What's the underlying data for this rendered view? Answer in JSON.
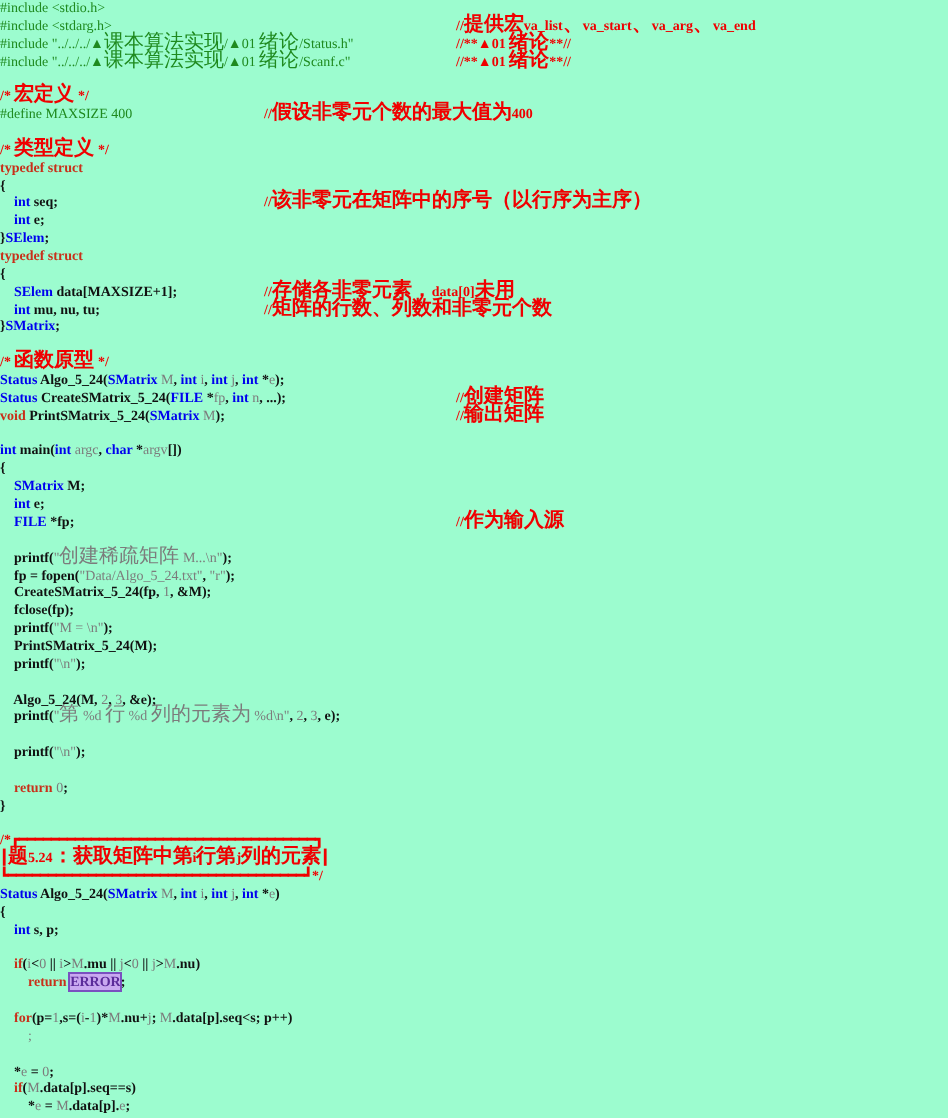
{
  "editor": {
    "lines": [
      {
        "kind": "code",
        "segments": [
          {
            "kind": "pre",
            "text": "#include <stdio.h>"
          }
        ]
      },
      {
        "kind": "code",
        "segments": [
          {
            "kind": "pre",
            "text": "#include <stdarg.h>"
          }
        ],
        "comment_far": "//提供宏va_list、va_start、va_arg、va_end"
      },
      {
        "kind": "code",
        "segments": [
          {
            "kind": "pre",
            "text": "#include \"../../../▲课本算法实现/▲01 绪论/Status.h\""
          }
        ],
        "comment_far": "//**▲01 绪论**//"
      },
      {
        "kind": "code",
        "segments": [
          {
            "kind": "pre",
            "text": "#include \"../../../▲课本算法实现/▲01 绪论/Scanf.c\""
          }
        ],
        "comment_far": "//**▲01 绪论**//"
      },
      {
        "kind": "blank"
      },
      {
        "kind": "code",
        "segments": [
          {
            "kind": "cmt",
            "text": "/* 宏定义 */"
          }
        ]
      },
      {
        "kind": "code",
        "segments": [
          {
            "kind": "pre",
            "text": "#define MAXSIZE 400"
          }
        ],
        "comment_mid": "//假设非零元个数的最大值为400"
      },
      {
        "kind": "blank"
      },
      {
        "kind": "code",
        "segments": [
          {
            "kind": "cmt",
            "text": "/* 类型定义 */"
          }
        ]
      },
      {
        "kind": "code",
        "segments": [
          {
            "kind": "ctl",
            "text": "typedef struct"
          }
        ]
      },
      {
        "kind": "code",
        "segments": [
          {
            "kind": "plain",
            "text": "{"
          }
        ]
      },
      {
        "kind": "code",
        "segments": [
          {
            "kind": "kw",
            "text": "    int"
          },
          {
            "kind": "plain",
            "text": " seq;"
          }
        ],
        "comment_mid": "//该非零元在矩阵中的序号（以行序为主序）"
      },
      {
        "kind": "code",
        "segments": [
          {
            "kind": "kw",
            "text": "    int"
          },
          {
            "kind": "plain",
            "text": " e;"
          }
        ]
      },
      {
        "kind": "code",
        "segments": [
          {
            "kind": "plain",
            "text": "}"
          },
          {
            "kind": "kw",
            "text": "SElem"
          },
          {
            "kind": "plain",
            "text": ";"
          }
        ]
      },
      {
        "kind": "code",
        "segments": [
          {
            "kind": "ctl",
            "text": "typedef struct"
          }
        ]
      },
      {
        "kind": "code",
        "segments": [
          {
            "kind": "plain",
            "text": "{"
          }
        ]
      },
      {
        "kind": "code",
        "segments": [
          {
            "kind": "kw",
            "text": "    SElem"
          },
          {
            "kind": "plain",
            "text": " data[MAXSIZE+1];"
          }
        ],
        "comment_mid": "//存储各非零元素，data[0]未用"
      },
      {
        "kind": "code",
        "segments": [
          {
            "kind": "kw",
            "text": "    int"
          },
          {
            "kind": "plain",
            "text": " mu, nu, tu;"
          }
        ],
        "comment_mid": "//矩阵的行数、列数和非零元个数"
      },
      {
        "kind": "code",
        "segments": [
          {
            "kind": "plain",
            "text": "}"
          },
          {
            "kind": "kw",
            "text": "SMatrix"
          },
          {
            "kind": "plain",
            "text": ";"
          }
        ]
      },
      {
        "kind": "blank"
      },
      {
        "kind": "code",
        "segments": [
          {
            "kind": "cmt",
            "text": "/* 函数原型 */"
          }
        ]
      },
      {
        "kind": "code",
        "segments": [
          {
            "kind": "kw",
            "text": "Status"
          },
          {
            "kind": "plain",
            "text": " Algo_5_24("
          },
          {
            "kind": "kw",
            "text": "SMatrix"
          },
          {
            "kind": "param",
            "text": " M"
          },
          {
            "kind": "plain",
            "text": ", "
          },
          {
            "kind": "kw",
            "text": "int"
          },
          {
            "kind": "param",
            "text": " i"
          },
          {
            "kind": "plain",
            "text": ", "
          },
          {
            "kind": "kw",
            "text": "int"
          },
          {
            "kind": "param",
            "text": " j"
          },
          {
            "kind": "plain",
            "text": ", "
          },
          {
            "kind": "kw",
            "text": "int"
          },
          {
            "kind": "plain",
            "text": " *"
          },
          {
            "kind": "param",
            "text": "e"
          },
          {
            "kind": "plain",
            "text": ");"
          }
        ]
      },
      {
        "kind": "code",
        "segments": [
          {
            "kind": "kw",
            "text": "Status"
          },
          {
            "kind": "plain",
            "text": " CreateSMatrix_5_24("
          },
          {
            "kind": "kw",
            "text": "FILE"
          },
          {
            "kind": "plain",
            "text": " *"
          },
          {
            "kind": "param",
            "text": "fp"
          },
          {
            "kind": "plain",
            "text": ", "
          },
          {
            "kind": "kw",
            "text": "int"
          },
          {
            "kind": "param",
            "text": " n"
          },
          {
            "kind": "plain",
            "text": ", ...);"
          }
        ],
        "comment_far": "//创建矩阵"
      },
      {
        "kind": "code",
        "segments": [
          {
            "kind": "ctl",
            "text": "void"
          },
          {
            "kind": "plain",
            "text": " PrintSMatrix_5_24("
          },
          {
            "kind": "kw",
            "text": "SMatrix"
          },
          {
            "kind": "param",
            "text": " M"
          },
          {
            "kind": "plain",
            "text": ");"
          }
        ],
        "comment_far": "//输出矩阵"
      },
      {
        "kind": "blank"
      },
      {
        "kind": "code",
        "segments": [
          {
            "kind": "kw",
            "text": "int"
          },
          {
            "kind": "plain",
            "text": " main("
          },
          {
            "kind": "kw",
            "text": "int"
          },
          {
            "kind": "param",
            "text": " argc"
          },
          {
            "kind": "plain",
            "text": ", "
          },
          {
            "kind": "kw",
            "text": "char"
          },
          {
            "kind": "plain",
            "text": " *"
          },
          {
            "kind": "param",
            "text": "argv"
          },
          {
            "kind": "plain",
            "text": "[])"
          }
        ]
      },
      {
        "kind": "code",
        "segments": [
          {
            "kind": "plain",
            "text": "{"
          }
        ]
      },
      {
        "kind": "code",
        "segments": [
          {
            "kind": "kw",
            "text": "    SMatrix"
          },
          {
            "kind": "plain",
            "text": " M;"
          }
        ]
      },
      {
        "kind": "code",
        "segments": [
          {
            "kind": "kw",
            "text": "    int"
          },
          {
            "kind": "plain",
            "text": " e;"
          }
        ]
      },
      {
        "kind": "code",
        "segments": [
          {
            "kind": "kw",
            "text": "    FILE"
          },
          {
            "kind": "plain",
            "text": " *fp;"
          }
        ],
        "comment_far": "//作为输入源"
      },
      {
        "kind": "blank"
      },
      {
        "kind": "code",
        "segments": [
          {
            "kind": "plain",
            "text": "    printf("
          },
          {
            "kind": "str",
            "text": "\"创建稀疏矩阵 M...\\n\""
          },
          {
            "kind": "plain",
            "text": ");"
          }
        ]
      },
      {
        "kind": "code",
        "segments": [
          {
            "kind": "plain",
            "text": "    fp = fopen("
          },
          {
            "kind": "str",
            "text": "\"Data/Algo_5_24.txt\""
          },
          {
            "kind": "plain",
            "text": ", "
          },
          {
            "kind": "str",
            "text": "\"r\""
          },
          {
            "kind": "plain",
            "text": ");"
          }
        ]
      },
      {
        "kind": "code",
        "segments": [
          {
            "kind": "plain",
            "text": "    CreateSMatrix_5_24(fp, "
          },
          {
            "kind": "num",
            "text": "1"
          },
          {
            "kind": "plain",
            "text": ", &M);"
          }
        ]
      },
      {
        "kind": "code",
        "segments": [
          {
            "kind": "plain",
            "text": "    fclose(fp);"
          }
        ]
      },
      {
        "kind": "code",
        "segments": [
          {
            "kind": "plain",
            "text": "    printf("
          },
          {
            "kind": "str",
            "text": "\"M = \\n\""
          },
          {
            "kind": "plain",
            "text": ");"
          }
        ]
      },
      {
        "kind": "code",
        "segments": [
          {
            "kind": "plain",
            "text": "    PrintSMatrix_5_24(M);"
          }
        ]
      },
      {
        "kind": "code",
        "segments": [
          {
            "kind": "plain",
            "text": "    printf("
          },
          {
            "kind": "str",
            "text": "\"\\n\""
          },
          {
            "kind": "plain",
            "text": ");"
          }
        ]
      },
      {
        "kind": "blank"
      },
      {
        "kind": "code",
        "segments": [
          {
            "kind": "plain",
            "text": "    Algo_5_24(M, "
          },
          {
            "kind": "num",
            "text": "2"
          },
          {
            "kind": "plain",
            "text": ", "
          },
          {
            "kind": "num",
            "text": "3"
          },
          {
            "kind": "plain",
            "text": ", &e);"
          }
        ]
      },
      {
        "kind": "code",
        "segments": [
          {
            "kind": "plain",
            "text": "    printf("
          },
          {
            "kind": "str",
            "text": "\"第 %d 行 %d 列的元素为 %d\\n\""
          },
          {
            "kind": "plain",
            "text": ", "
          },
          {
            "kind": "num",
            "text": "2"
          },
          {
            "kind": "plain",
            "text": ", "
          },
          {
            "kind": "num",
            "text": "3"
          },
          {
            "kind": "plain",
            "text": ", e);"
          }
        ]
      },
      {
        "kind": "blank"
      },
      {
        "kind": "code",
        "segments": [
          {
            "kind": "plain",
            "text": "    printf("
          },
          {
            "kind": "str",
            "text": "\"\\n\""
          },
          {
            "kind": "plain",
            "text": ");"
          }
        ]
      },
      {
        "kind": "blank"
      },
      {
        "kind": "code",
        "segments": [
          {
            "kind": "ctl",
            "text": "    return "
          },
          {
            "kind": "num",
            "text": "0"
          },
          {
            "kind": "plain",
            "text": ";"
          }
        ]
      },
      {
        "kind": "code",
        "segments": [
          {
            "kind": "plain",
            "text": "}"
          }
        ]
      },
      {
        "kind": "blank"
      },
      {
        "kind": "code",
        "segments": [
          {
            "kind": "cmt",
            "text": "/*┏━━━━━━━━━━━━━━━━━━━━━━━━━━━━━━━━━━━━━┓"
          }
        ]
      },
      {
        "kind": "code",
        "segments": [
          {
            "kind": "cmt",
            "text": "┃题5.24：获取矩阵中第i行第j列的元素┃"
          }
        ]
      },
      {
        "kind": "code",
        "segments": [
          {
            "kind": "cmt",
            "text": "┗━━━━━━━━━━━━━━━━━━━━━━━━━━━━━━━━━━━━━┛*/"
          }
        ]
      },
      {
        "kind": "code",
        "segments": [
          {
            "kind": "kw",
            "text": "Status"
          },
          {
            "kind": "plain",
            "text": " Algo_5_24("
          },
          {
            "kind": "kw",
            "text": "SMatrix"
          },
          {
            "kind": "param",
            "text": " M"
          },
          {
            "kind": "plain",
            "text": ", "
          },
          {
            "kind": "kw",
            "text": "int"
          },
          {
            "kind": "param",
            "text": " i"
          },
          {
            "kind": "plain",
            "text": ", "
          },
          {
            "kind": "kw",
            "text": "int"
          },
          {
            "kind": "param",
            "text": " j"
          },
          {
            "kind": "plain",
            "text": ", "
          },
          {
            "kind": "kw",
            "text": "int"
          },
          {
            "kind": "plain",
            "text": " *"
          },
          {
            "kind": "param",
            "text": "e"
          },
          {
            "kind": "plain",
            "text": ")"
          }
        ]
      },
      {
        "kind": "code",
        "segments": [
          {
            "kind": "plain",
            "text": "{"
          }
        ]
      },
      {
        "kind": "code",
        "segments": [
          {
            "kind": "kw",
            "text": "    int"
          },
          {
            "kind": "plain",
            "text": " s, p;"
          }
        ]
      },
      {
        "kind": "blank"
      },
      {
        "kind": "code",
        "segments": [
          {
            "kind": "ctl",
            "text": "    if"
          },
          {
            "kind": "plain",
            "text": "("
          },
          {
            "kind": "param",
            "text": "i"
          },
          {
            "kind": "plain",
            "text": "<"
          },
          {
            "kind": "num",
            "text": "0"
          },
          {
            "kind": "plain",
            "text": " || "
          },
          {
            "kind": "param",
            "text": "i"
          },
          {
            "kind": "plain",
            "text": ">"
          },
          {
            "kind": "param",
            "text": "M"
          },
          {
            "kind": "plain",
            "text": ".mu || "
          },
          {
            "kind": "param",
            "text": "j"
          },
          {
            "kind": "plain",
            "text": "<"
          },
          {
            "kind": "num",
            "text": "0"
          },
          {
            "kind": "plain",
            "text": " || "
          },
          {
            "kind": "param",
            "text": "j"
          },
          {
            "kind": "plain",
            "text": ">"
          },
          {
            "kind": "param",
            "text": "M"
          },
          {
            "kind": "plain",
            "text": ".nu)"
          }
        ]
      },
      {
        "kind": "code",
        "segments": [
          {
            "kind": "ctl",
            "text": "        return "
          },
          {
            "kind": "macro",
            "text": "ERROR"
          },
          {
            "kind": "plain",
            "text": ";"
          }
        ]
      },
      {
        "kind": "blank"
      },
      {
        "kind": "code",
        "segments": [
          {
            "kind": "ctl",
            "text": "    for"
          },
          {
            "kind": "plain",
            "text": "(p="
          },
          {
            "kind": "num",
            "text": "1"
          },
          {
            "kind": "plain",
            "text": ",s=("
          },
          {
            "kind": "param",
            "text": "i"
          },
          {
            "kind": "plain",
            "text": "-"
          },
          {
            "kind": "num",
            "text": "1"
          },
          {
            "kind": "plain",
            "text": ")*"
          },
          {
            "kind": "param",
            "text": "M"
          },
          {
            "kind": "plain",
            "text": ".nu+"
          },
          {
            "kind": "param",
            "text": "j"
          },
          {
            "kind": "plain",
            "text": "; "
          },
          {
            "kind": "param",
            "text": "M"
          },
          {
            "kind": "plain",
            "text": ".data[p].seq<s; p++)"
          }
        ]
      },
      {
        "kind": "code",
        "segments": [
          {
            "kind": "num",
            "text": "        ;"
          }
        ]
      },
      {
        "kind": "blank"
      },
      {
        "kind": "code",
        "segments": [
          {
            "kind": "plain",
            "text": "    *"
          },
          {
            "kind": "param",
            "text": "e"
          },
          {
            "kind": "plain",
            "text": " = "
          },
          {
            "kind": "num",
            "text": "0"
          },
          {
            "kind": "plain",
            "text": ";"
          }
        ]
      },
      {
        "kind": "code",
        "segments": [
          {
            "kind": "ctl",
            "text": "    if"
          },
          {
            "kind": "plain",
            "text": "("
          },
          {
            "kind": "param",
            "text": "M"
          },
          {
            "kind": "plain",
            "text": ".data[p].seq==s)"
          }
        ]
      },
      {
        "kind": "code",
        "segments": [
          {
            "kind": "plain",
            "text": "        *"
          },
          {
            "kind": "param",
            "text": "e"
          },
          {
            "kind": "plain",
            "text": " = "
          },
          {
            "kind": "param",
            "text": "M"
          },
          {
            "kind": "plain",
            "text": ".data[p]."
          },
          {
            "kind": "param",
            "text": "e"
          },
          {
            "kind": "plain",
            "text": ";"
          }
        ]
      }
    ]
  }
}
